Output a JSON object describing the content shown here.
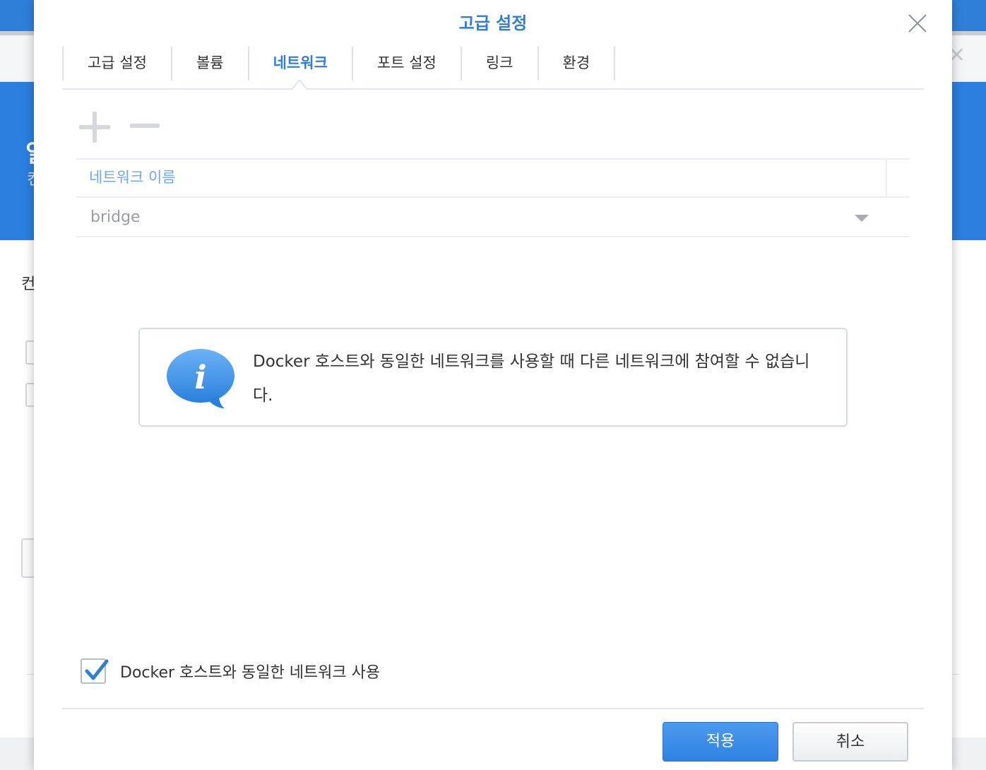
{
  "background_window": {
    "banner_glyph_1": "일",
    "banner_glyph_2": "컨",
    "label_glyph": "컨",
    "close_glyph": "✕"
  },
  "dialog": {
    "title": "고급 설정",
    "close_icon": "close-icon",
    "tabs": [
      {
        "label": "고급 설정",
        "active": false
      },
      {
        "label": "볼륨",
        "active": false
      },
      {
        "label": "네트워크",
        "active": true
      },
      {
        "label": "포트 설정",
        "active": false
      },
      {
        "label": "링크",
        "active": false
      },
      {
        "label": "환경",
        "active": false
      }
    ],
    "toolbar": {
      "add_icon": "plus-icon",
      "remove_icon": "minus-icon"
    },
    "network_table": {
      "column_header": "네트워크 이름",
      "rows": [
        {
          "network_name": "bridge",
          "dropdown_icon": "dropdown-arrow-icon"
        }
      ]
    },
    "info_message": {
      "icon": "info-bubble-icon",
      "text": "Docker 호스트와 동일한 네트워크를 사용할 때 다른 네트워크에 참여할 수 없습니다."
    },
    "host_network_checkbox": {
      "checked": true,
      "label": "Docker 호스트와 동일한 네트워크 사용"
    },
    "buttons": {
      "apply": "적용",
      "cancel": "취소"
    },
    "colors": {
      "accent": "#2f7fd9",
      "header_text": "#6fa9ea",
      "apply_button": "#3a8ae6"
    }
  }
}
